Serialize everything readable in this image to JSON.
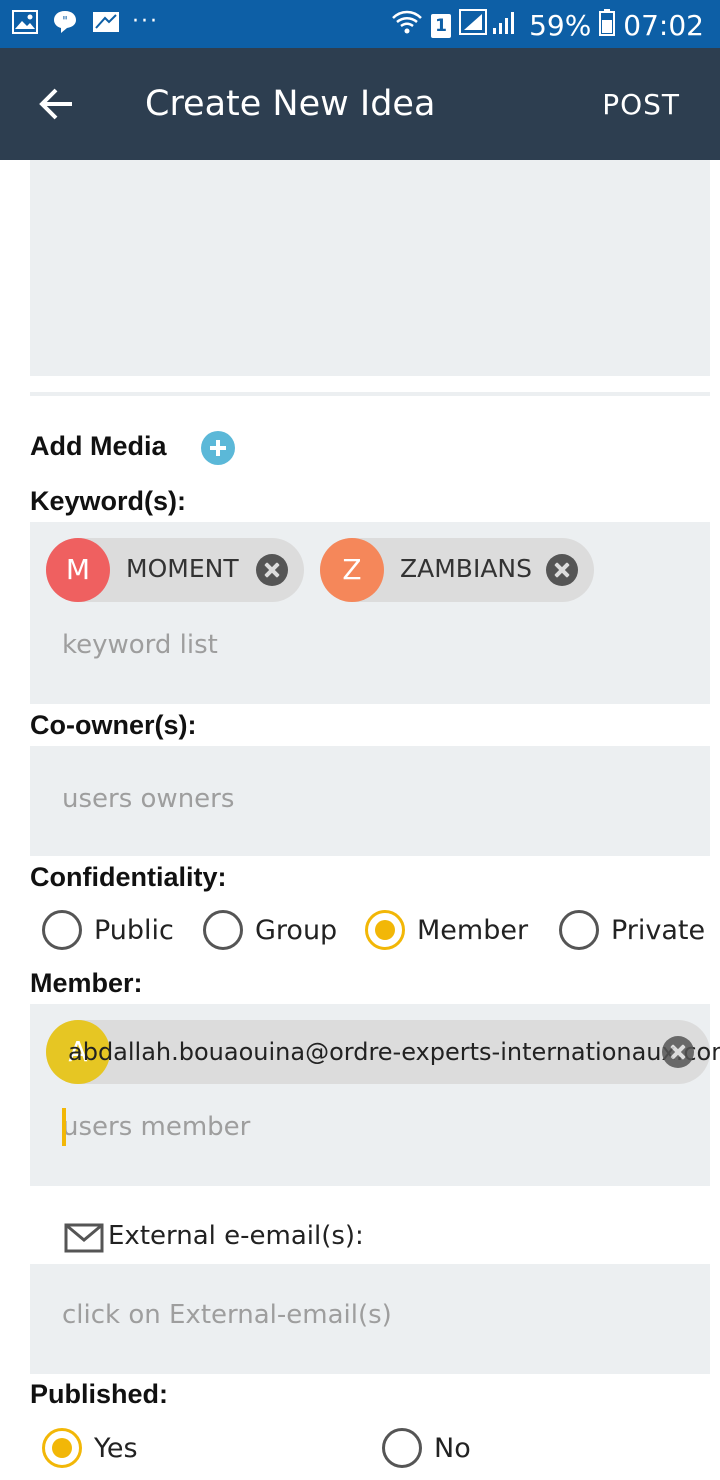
{
  "status_bar": {
    "icons": [
      "gallery-icon",
      "quote-icon",
      "app-icon",
      "wifi-icon",
      "signal-icon",
      "battery-icon"
    ],
    "more": "···",
    "sim": "1",
    "battery": "59%",
    "time": "07:02"
  },
  "app_bar": {
    "title": "Create New Idea",
    "post_label": "POST"
  },
  "form": {
    "add_media_label": "Add Media",
    "keywords_label": "Keyword(s):",
    "keywords": [
      {
        "initial": "M",
        "label": "MOMENT",
        "color": "#ef6060"
      },
      {
        "initial": "Z",
        "label": "ZAMBIANS",
        "color": "#f5875a"
      }
    ],
    "keywords_placeholder": "keyword list",
    "coowners_label": "Co-owner(s):",
    "coowners_placeholder": "users owners",
    "confidentiality_label": "Confidentiality:",
    "confidentiality_options": [
      {
        "label": "Public",
        "checked": false
      },
      {
        "label": "Group",
        "checked": false
      },
      {
        "label": "Member",
        "checked": true
      },
      {
        "label": "Private",
        "checked": false
      }
    ],
    "member_label": "Member:",
    "members": [
      {
        "initial": "A",
        "email": "abdallah.bouaouina@ordre-experts-internationaux.com",
        "color": "#e6c623"
      }
    ],
    "members_placeholder": "users member",
    "external_email_label": "External e-email(s):",
    "external_email_placeholder": "click on External-email(s)",
    "published_label": "Published:",
    "published_options": [
      {
        "label": "Yes",
        "checked": true
      },
      {
        "label": "No",
        "checked": false
      }
    ]
  },
  "colors": {
    "status_bar": "#0d5fa6",
    "app_bar": "#2d3e50",
    "field_bg": "#eceff1",
    "accent": "#f2b707",
    "add_media": "#5bb8d8"
  }
}
